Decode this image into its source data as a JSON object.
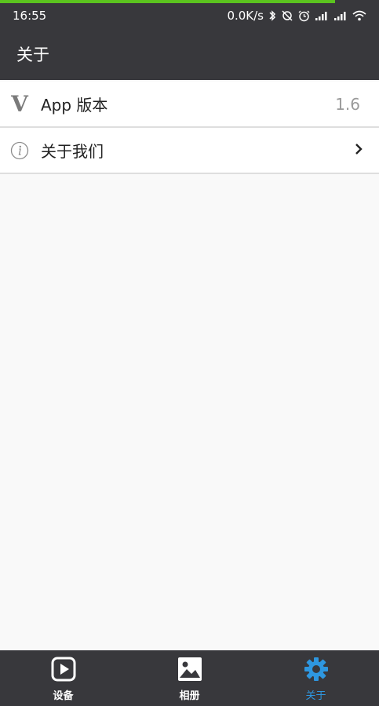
{
  "status_bar": {
    "time": "16:55",
    "network_speed": "0.0K/s",
    "icons": [
      "bluetooth-icon",
      "sync-off-icon",
      "alarm-icon",
      "signal-icon",
      "signal-icon",
      "wifi-icon"
    ]
  },
  "header": {
    "title": "关于"
  },
  "list": {
    "items": [
      {
        "icon": "version-v-icon",
        "label": "App 版本",
        "value": "1.6"
      },
      {
        "icon": "info-icon",
        "label": "关于我们",
        "value": ""
      }
    ]
  },
  "tabbar": {
    "tabs": [
      {
        "icon": "play-icon",
        "label": "设备",
        "active": false
      },
      {
        "icon": "image-icon",
        "label": "相册",
        "active": false
      },
      {
        "icon": "gear-icon",
        "label": "关于",
        "active": true
      }
    ],
    "active_color": "#2e97e0"
  },
  "colors": {
    "bar": "#38383c",
    "progress": "#5bc41f",
    "background": "#f9f9f9"
  }
}
